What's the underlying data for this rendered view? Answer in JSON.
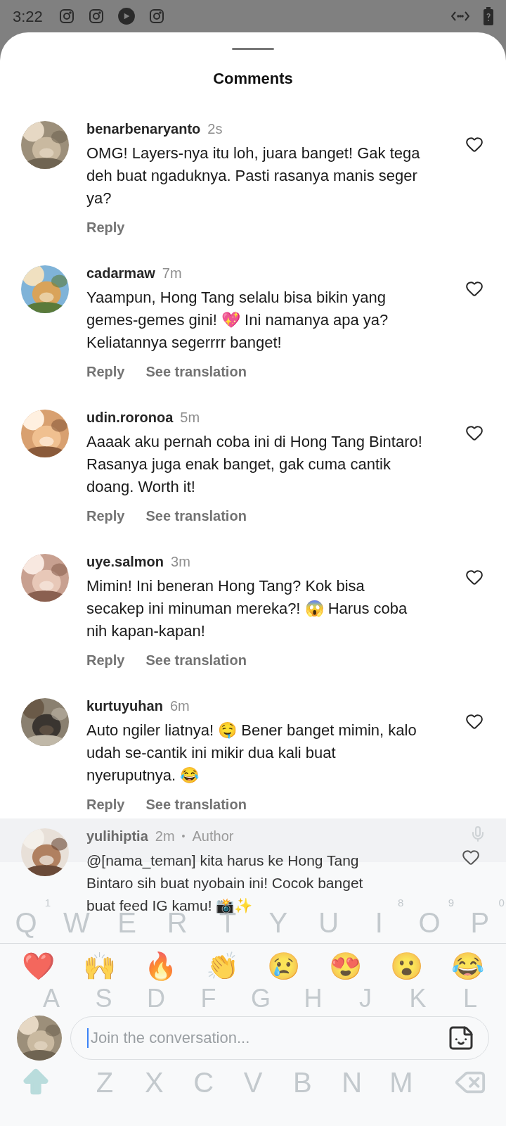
{
  "status_bar": {
    "time": "3:22"
  },
  "title": "Comments",
  "comments": [
    {
      "user": "benarbenaryanto",
      "time": "2s",
      "text": "OMG! Layers-nya itu loh, juara banget! Gak tega deh buat ngaduknya. Pasti rasanya manis seger ya?",
      "actions": [
        "Reply"
      ],
      "liked": false
    },
    {
      "user": "cadarmaw",
      "time": "7m",
      "text": "Yaampun, Hong Tang selalu bisa bikin yang gemes-gemes gini! 💖 Ini namanya apa ya? Keliatannya segerrrr banget!",
      "actions": [
        "Reply",
        "See translation"
      ],
      "liked": false
    },
    {
      "user": "udin.roronoa",
      "time": "5m",
      "text": "Aaaak aku pernah coba ini di Hong Tang Bintaro! Rasanya juga enak banget, gak cuma cantik doang. Worth it!",
      "actions": [
        "Reply",
        "See translation"
      ],
      "liked": false
    },
    {
      "user": "uye.salmon",
      "time": "3m",
      "text": "Mimin! Ini beneran Hong Tang? Kok bisa secakep ini minuman mereka?! 😱 Harus coba nih kapan-kapan!",
      "actions": [
        "Reply",
        "See translation"
      ],
      "liked": false
    },
    {
      "user": "kurtuyuhan",
      "time": "6m",
      "text": "Auto ngiler liatnya! 🤤 Bener banget mimin, kalo udah se-cantik ini mikir dua kali buat nyeruputnya. 😂",
      "actions": [
        "Reply",
        "See translation"
      ],
      "liked": false
    }
  ],
  "pinned_comment": {
    "user": "yulihiptia",
    "time": "2m",
    "separator": "•",
    "badge": "Author",
    "text": "@[nama_teman] kita harus ke Hong Tang Bintaro sih buat nyobain ini! Cocok banget buat feed IG kamu! 📸✨",
    "liked": false
  },
  "reactions": [
    "❤️",
    "🙌",
    "🔥",
    "👏",
    "😢",
    "😍",
    "😮",
    "😂"
  ],
  "composer": {
    "placeholder": "Join the conversation..."
  },
  "keyboard": {
    "top_row": [
      {
        "key": "Q",
        "hint": "1"
      },
      {
        "key": "W"
      },
      {
        "key": "E"
      },
      {
        "key": "R"
      },
      {
        "key": "T"
      },
      {
        "key": "Y"
      },
      {
        "key": "U"
      },
      {
        "key": "I",
        "hint": "8"
      },
      {
        "key": "O",
        "hint": "9"
      },
      {
        "key": "P",
        "hint": "0"
      }
    ],
    "middle_row": [
      "A",
      "S",
      "D",
      "F",
      "G",
      "H",
      "J",
      "K",
      "L"
    ],
    "bottom_row": [
      "Z",
      "X",
      "C",
      "V",
      "B",
      "N",
      "M"
    ]
  }
}
